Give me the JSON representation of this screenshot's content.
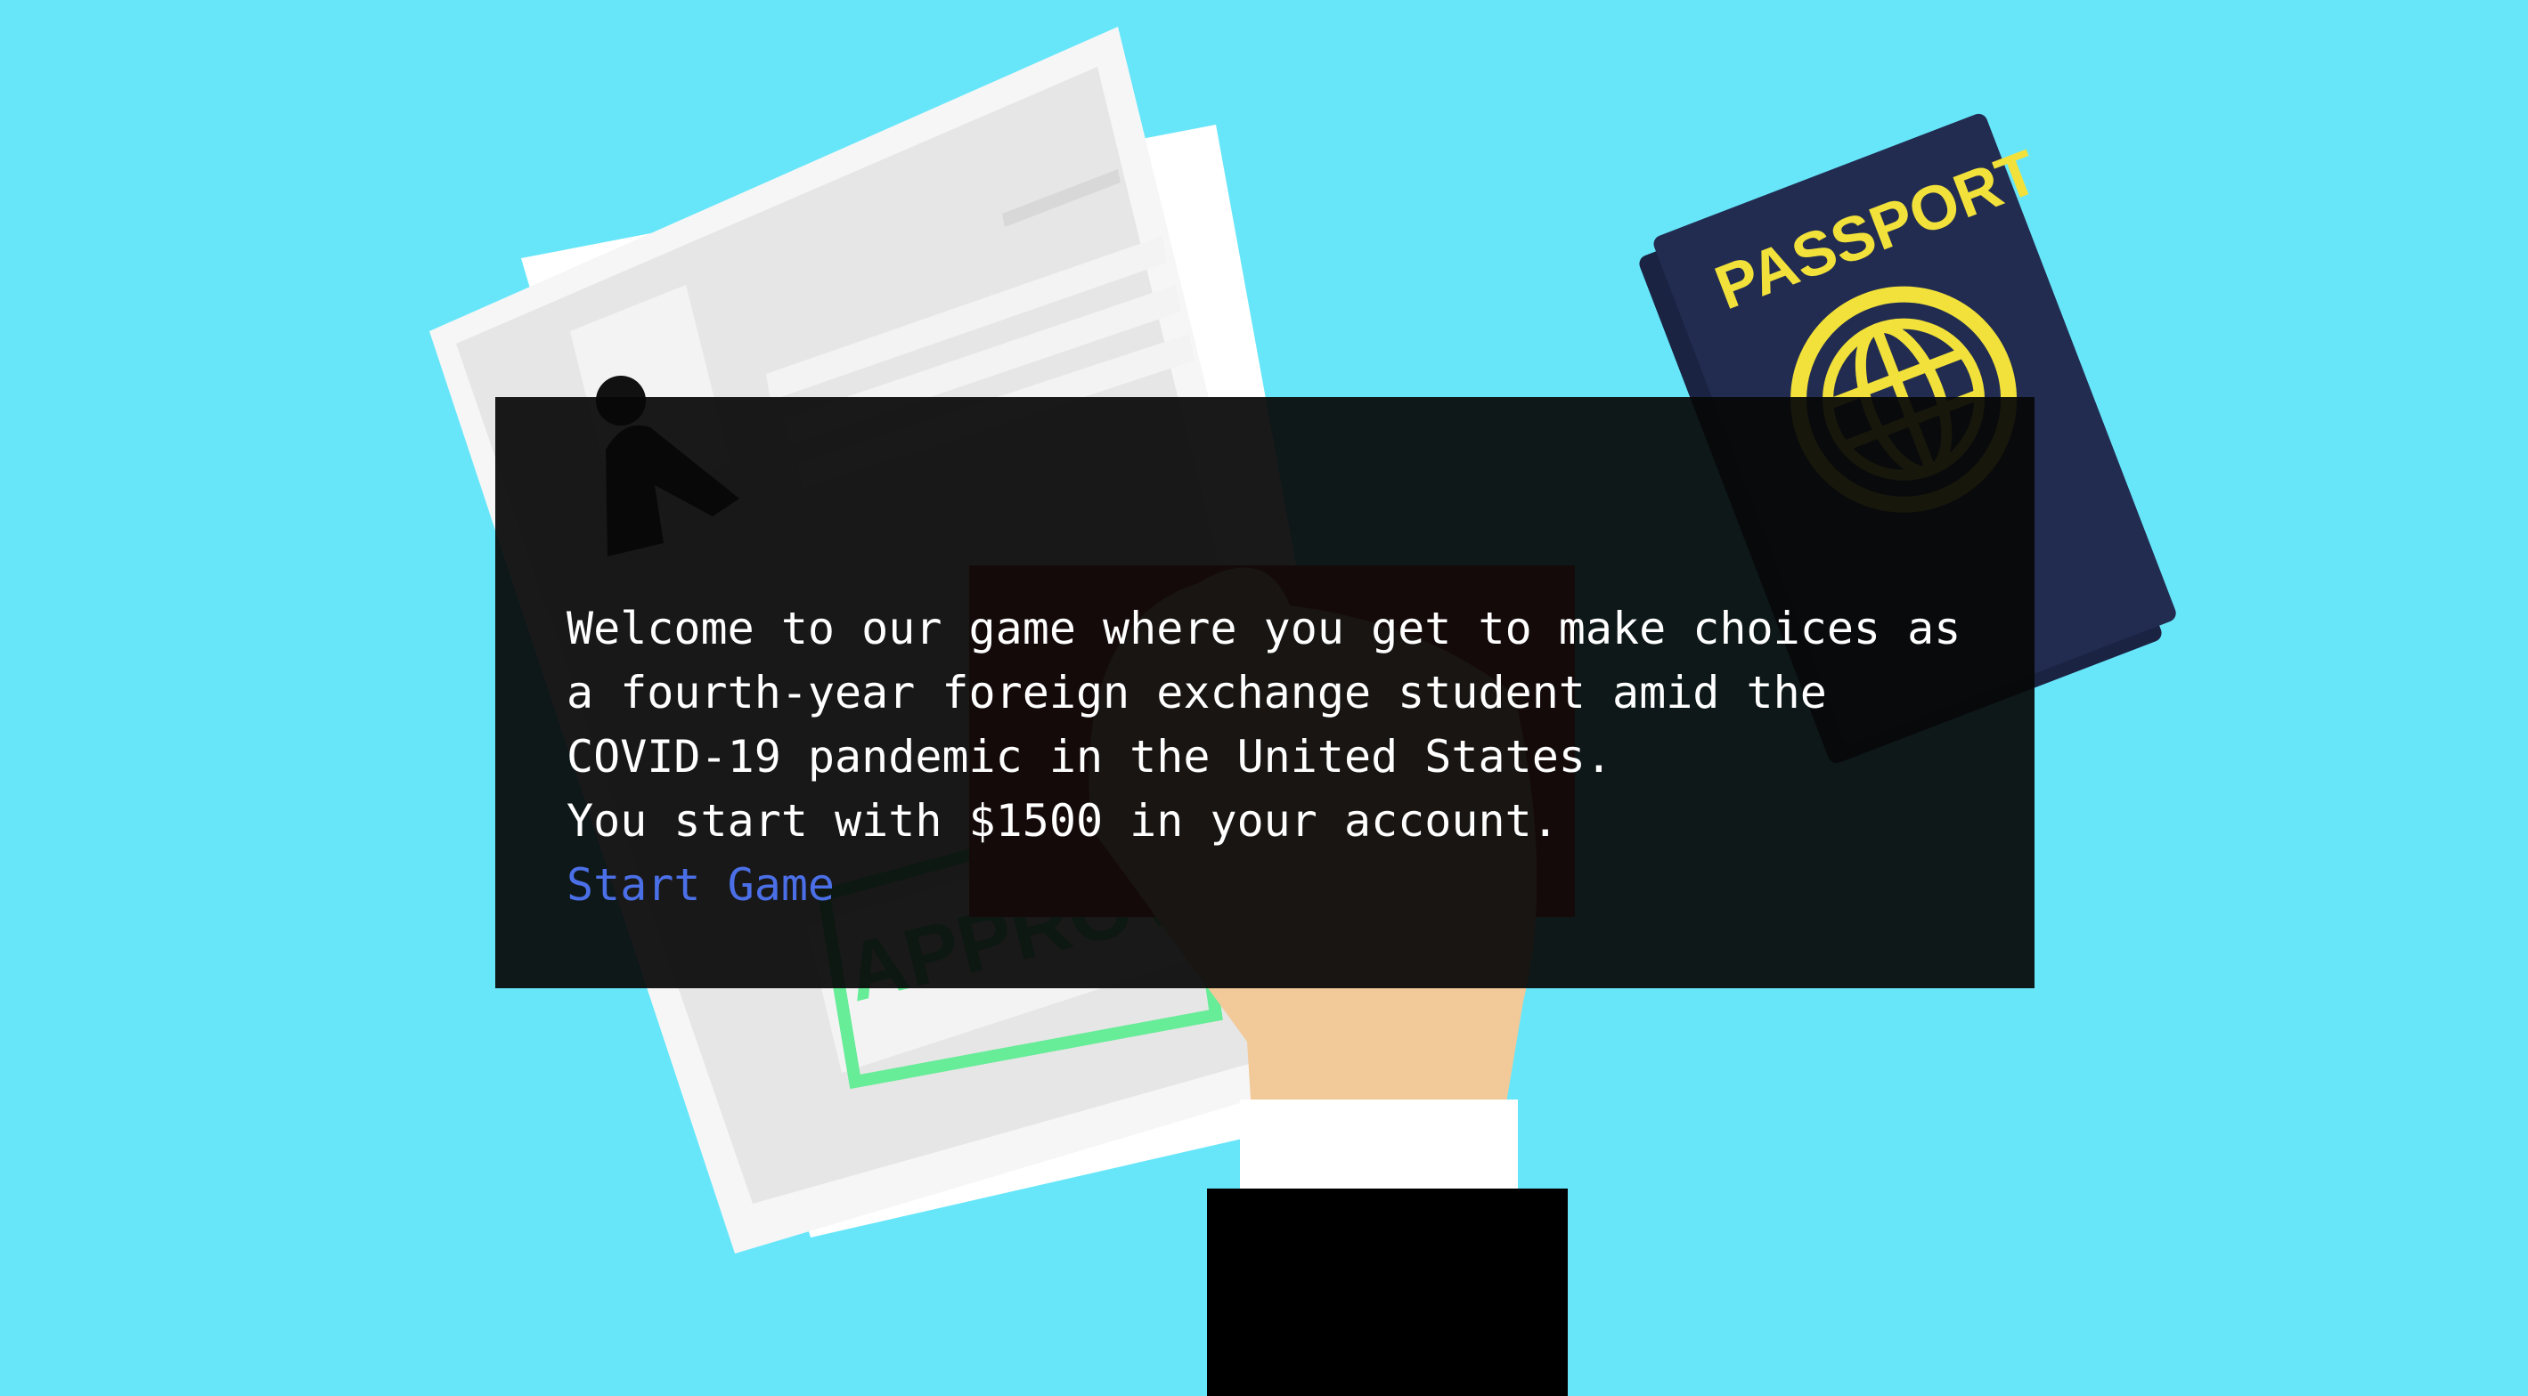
{
  "background": {
    "sky_color": "#67e6fa",
    "illustration": {
      "passport_label": "PASSPORT",
      "stamp_label": "APPROVED"
    }
  },
  "dialog": {
    "intro": "Welcome to our game where you get to make choices as a fourth-year foreign exchange student amid the COVID-19 pandemic in the United States.",
    "balance_line": "You start with $1500 in your account.",
    "start_link": "Start Game",
    "link_color": "#4b6fe6"
  }
}
